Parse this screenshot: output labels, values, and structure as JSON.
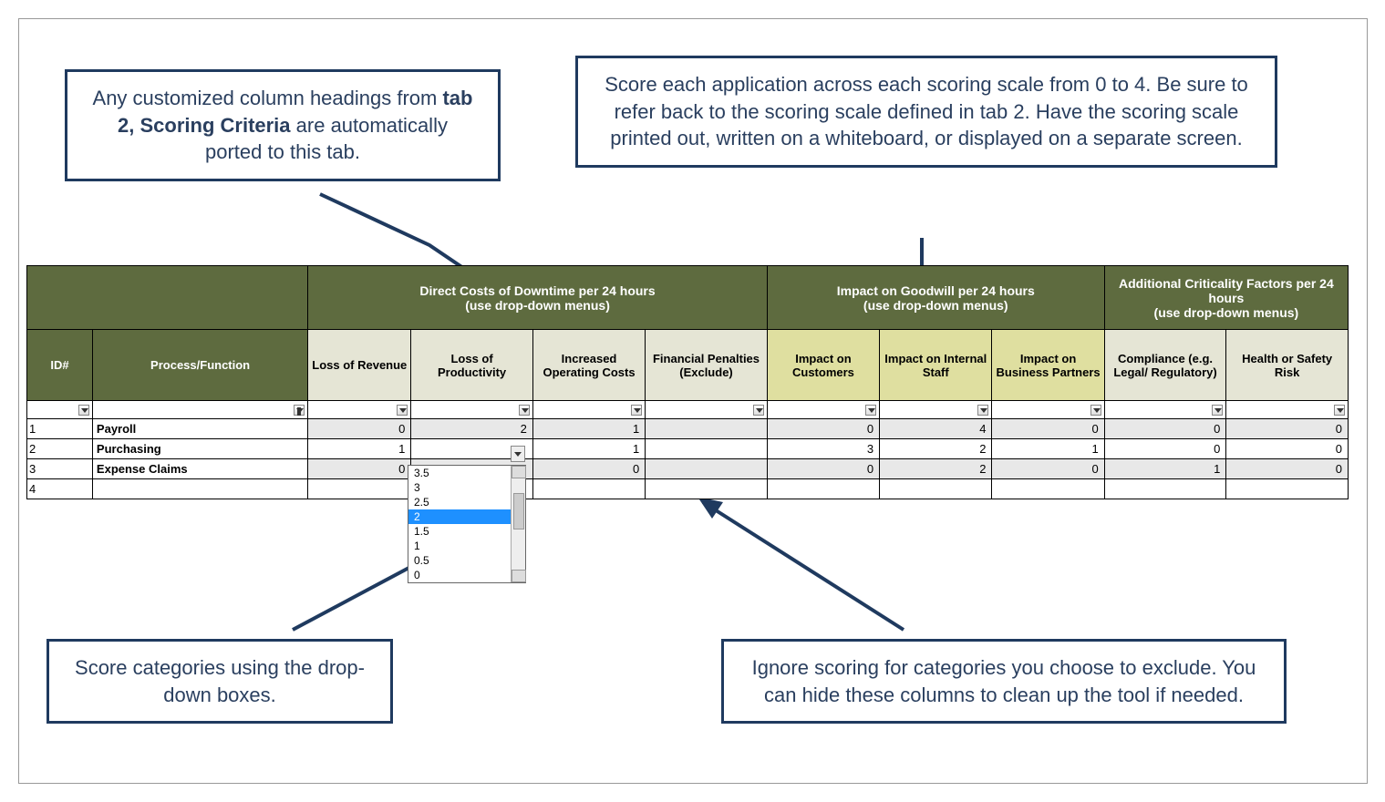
{
  "callouts": {
    "top_left_pre": "Any customized column headings from ",
    "top_left_bold": "tab 2, Scoring Criteria",
    "top_left_post": " are automatically ported to this tab.",
    "top_right": "Score each application across each scoring scale from 0 to 4. Be sure to refer back to the scoring scale defined in tab 2. Have the scoring scale printed out, written on a whiteboard, or displayed on a separate screen.",
    "bottom_left": "Score categories using the drop-down boxes.",
    "bottom_right": "Ignore scoring for categories you choose to exclude. You can hide these columns to clean up the tool if needed."
  },
  "group_headers": {
    "g1": "Direct Costs of Downtime per 24 hours\n(use drop-down menus)",
    "g2": "Impact on Goodwill per 24 hours\n(use drop-down menus)",
    "g3": "Additional Criticality Factors per 24 hours\n(use drop-down menus)"
  },
  "columns": {
    "id": "ID#",
    "process": "Process/Function",
    "c1": "Loss of Revenue",
    "c2": "Loss of Productivity",
    "c3": "Increased Operating Costs",
    "c4": "Financial Penalties (Exclude)",
    "c5": "Impact on Customers",
    "c6": "Impact on Internal Staff",
    "c7": "Impact on Business Partners",
    "c8": "Compliance (e.g. Legal/ Regulatory)",
    "c9": "Health or Safety Risk"
  },
  "rows": [
    {
      "id": "1",
      "process": "Payroll",
      "v": [
        "0",
        "2",
        "1",
        "",
        "0",
        "4",
        "0",
        "0",
        "0"
      ]
    },
    {
      "id": "2",
      "process": "Purchasing",
      "v": [
        "1",
        "",
        "1",
        "",
        "3",
        "2",
        "1",
        "0",
        "0"
      ]
    },
    {
      "id": "3",
      "process": "Expense Claims",
      "v": [
        "0",
        "",
        "0",
        "",
        "0",
        "2",
        "0",
        "1",
        "0"
      ]
    },
    {
      "id": "4",
      "process": "",
      "v": [
        "",
        "",
        "",
        "",
        "",
        "",
        "",
        "",
        ""
      ]
    }
  ],
  "dropdown_options": [
    "3.5",
    "3",
    "2.5",
    "2",
    "1.5",
    "1",
    "0.5",
    "0"
  ],
  "dropdown_selected_index": 3
}
